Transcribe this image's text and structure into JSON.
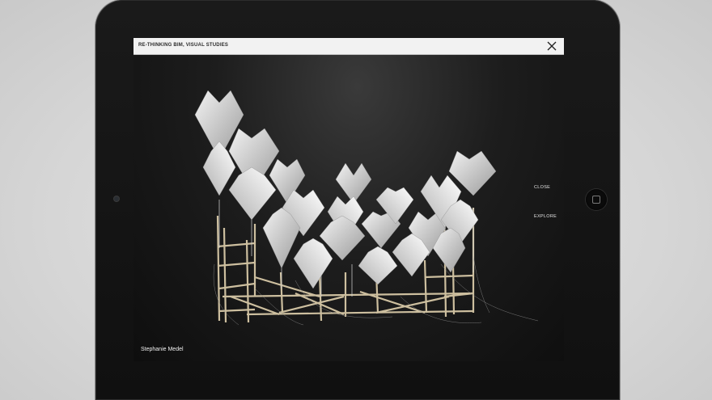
{
  "window": {
    "title": "RE-THINKING BIM, VISUAL STUDIES",
    "close_icon": "close-icon"
  },
  "side_menu": {
    "items": [
      {
        "label": "CLOSE"
      },
      {
        "label": "EXPLORE"
      }
    ]
  },
  "artwork": {
    "caption": "Stephanie Medel",
    "description_icon": "origami-installation-image"
  },
  "device": {
    "frame_color": "#141414",
    "screen_bg": "#151515",
    "titlebar_bg": "#f2f2f2"
  }
}
